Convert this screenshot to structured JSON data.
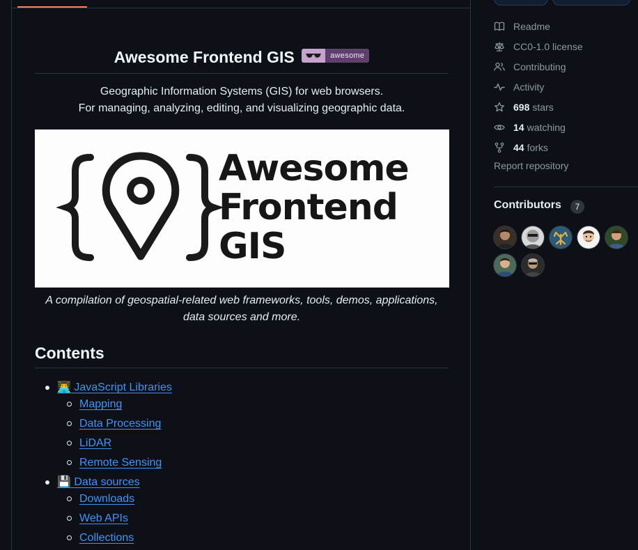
{
  "readme": {
    "title": "Awesome Frontend GIS",
    "badge_label": "awesome",
    "intro_line1": "Geographic Information Systems (GIS) for web browsers.",
    "intro_line2": "For managing, analyzing, editing, and visualizing geographic data.",
    "hero_lines": [
      "Awesome",
      "Frontend",
      "GIS"
    ],
    "caption_line1": "A compilation of geospatial-related web frameworks, tools, demos, applications,",
    "caption_line2": "data sources and more.",
    "contents_heading": "Contents",
    "toc": [
      {
        "emoji": "👨‍💻",
        "label": "JavaScript Libraries",
        "children": [
          "Mapping",
          "Data Processing",
          "LiDAR",
          "Remote Sensing"
        ]
      },
      {
        "emoji": "💾",
        "label": "Data sources",
        "children": [
          "Downloads",
          "Web APIs",
          "Collections"
        ]
      }
    ]
  },
  "sidebar": {
    "readme": "Readme",
    "license": "CC0-1.0 license",
    "contributing": "Contributing",
    "activity": "Activity",
    "stars_count": "698",
    "stars_label": "stars",
    "watching_count": "14",
    "watching_label": "watching",
    "forks_count": "44",
    "forks_label": "forks",
    "report": "Report repository",
    "contributors_heading": "Contributors",
    "contributors_count": "7",
    "icons": [
      "book-icon",
      "law-icon",
      "people-icon",
      "pulse-icon",
      "star-icon",
      "eye-icon",
      "fork-icon"
    ]
  },
  "colors": {
    "background": "#0d1117",
    "link": "#4493f8",
    "muted": "#9198a1",
    "border": "#30363d",
    "tab_accent": "#f78166"
  }
}
